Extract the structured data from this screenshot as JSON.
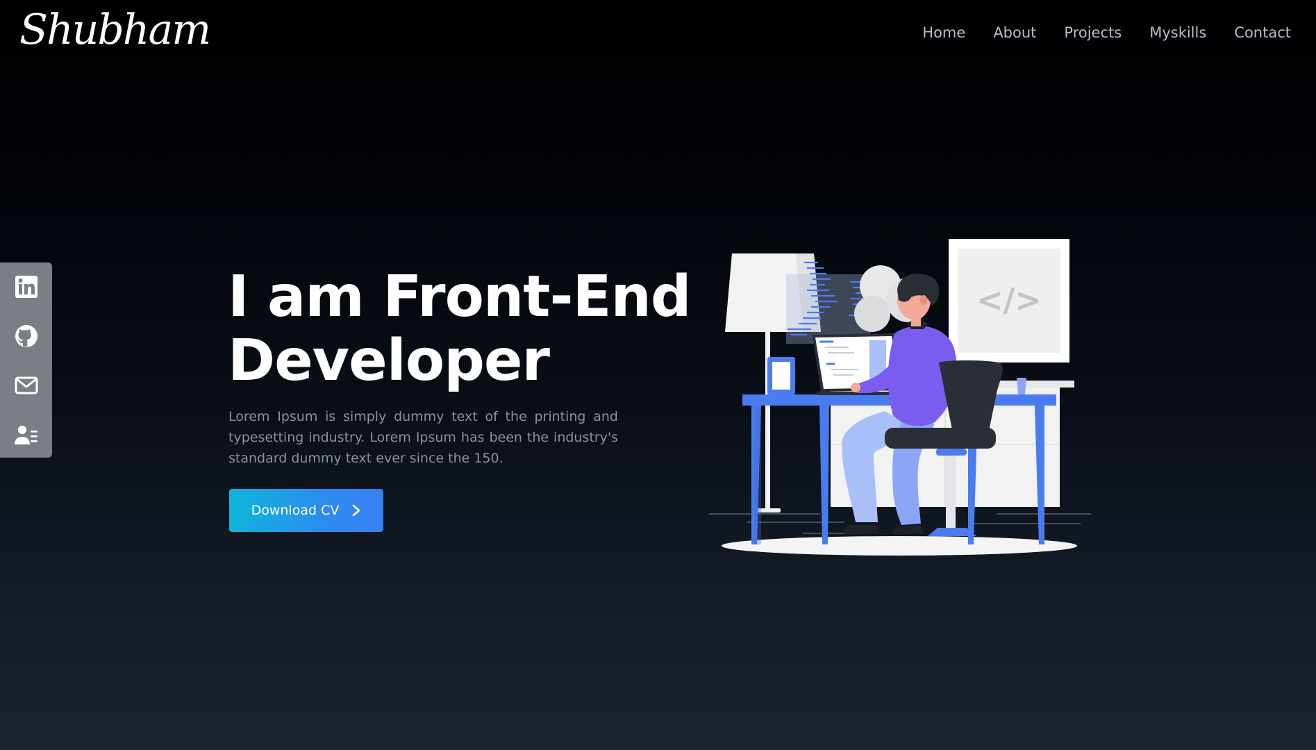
{
  "brand": {
    "logo_text": "Shubham"
  },
  "nav": {
    "items": [
      {
        "label": "Home"
      },
      {
        "label": "About"
      },
      {
        "label": "Projects"
      },
      {
        "label": "Myskills"
      },
      {
        "label": "Contact"
      }
    ]
  },
  "social": {
    "icons": [
      "linkedin-icon",
      "github-icon",
      "mail-icon",
      "contact-card-icon"
    ]
  },
  "hero": {
    "title_line1": "I am Front-End",
    "title_line2": "Developer",
    "description": "Lorem Ipsum is simply dummy text of the printing and typesetting industry. Lorem Ipsum has been the industry's standard dummy text ever since the 150.",
    "cta_label": "Download CV",
    "cta_icon": "chevron-right-icon",
    "screen_code_text": "</>"
  },
  "colors": {
    "accent_start": "#0eb6d9",
    "accent_end": "#3a80f2",
    "desk_blue": "#4a7cf0",
    "shirt_purple": "#7b5cf0",
    "sidebar_gray": "#7a7f86"
  }
}
